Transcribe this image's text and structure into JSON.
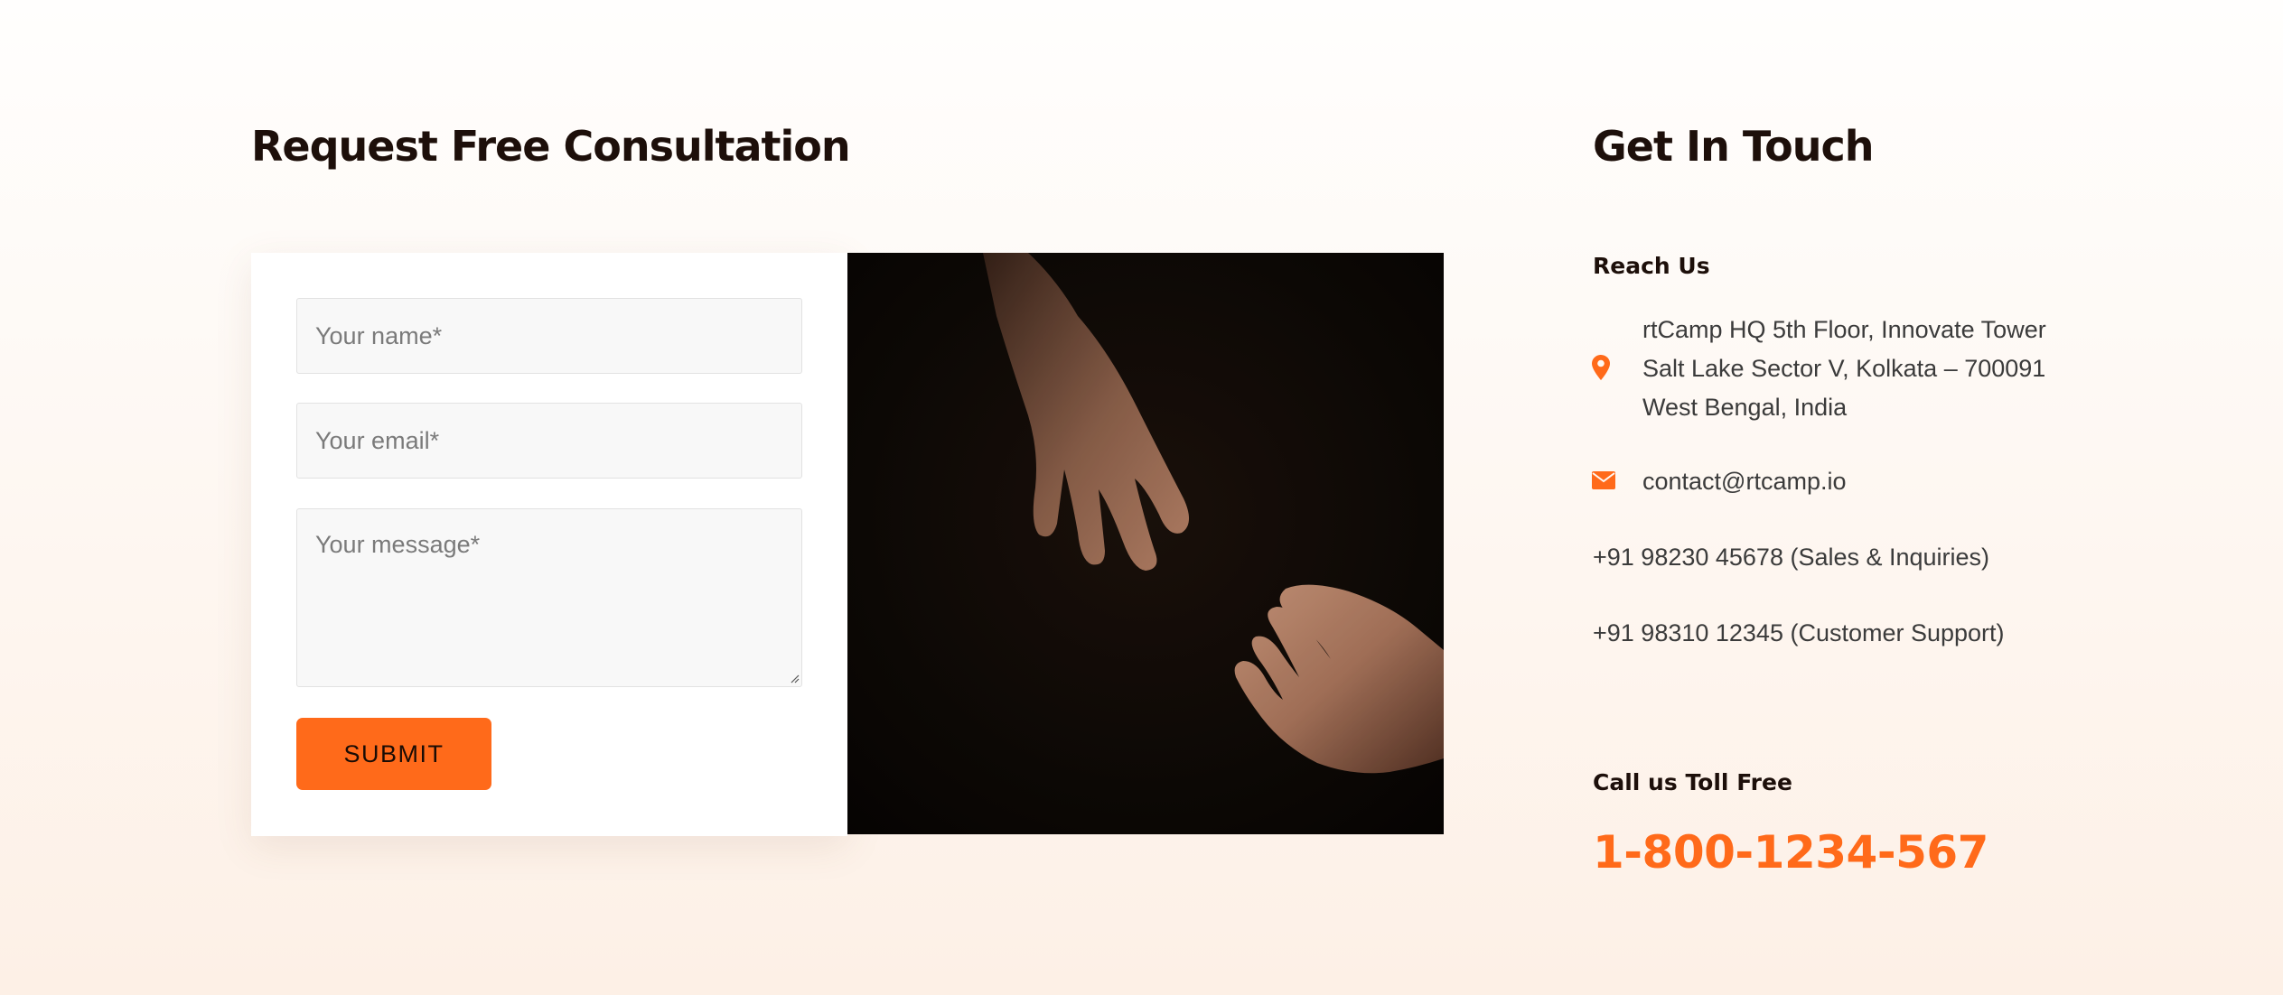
{
  "consultation": {
    "title": "Request Free Consultation",
    "form": {
      "name_placeholder": "Your name*",
      "email_placeholder": "Your email*",
      "message_placeholder": "Your message*",
      "submit_label": "SUBMIT"
    }
  },
  "contact": {
    "title": "Get In Touch",
    "reach_us_heading": "Reach Us",
    "address": "rtCamp HQ 5th Floor, Innovate Tower Salt Lake Sector V, Kolkata – 700091 West Bengal, India",
    "email": "contact@rtcamp.io",
    "phone_sales": "+91 98230 45678 (Sales & Inquiries)",
    "phone_support": "+91 98310 12345 (Customer Support)",
    "toll_free_heading": "Call us Toll Free",
    "toll_free_number": "1-800-1234-567"
  },
  "icons": {
    "address": "map-pin-icon",
    "email": "envelope-icon"
  },
  "colors": {
    "accent": "#ff6a1a",
    "heading": "#1d0f0a",
    "body_text": "#3b3b3b",
    "card_background": "#ffffff",
    "field_background": "#f8f8f8",
    "photo_background": "#0b0704"
  }
}
